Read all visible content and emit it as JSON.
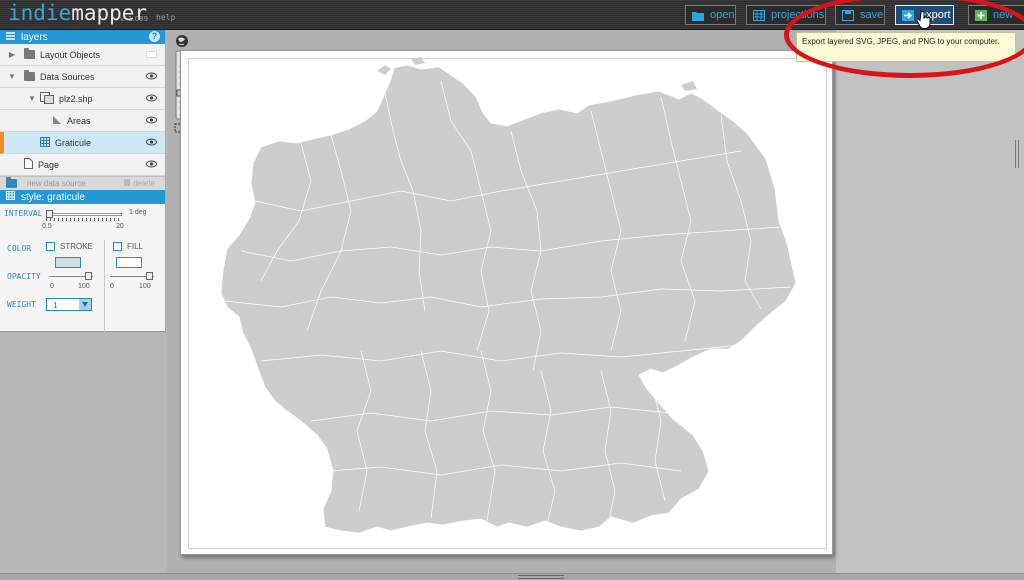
{
  "app": {
    "brand_part1": "indie",
    "brand_part2": "mapper",
    "version": "v. 1.089",
    "help": "help"
  },
  "toolbar": {
    "open": "open",
    "projections": "projections",
    "save": "save",
    "export": "export",
    "new": "new"
  },
  "tooltip": {
    "text": "Export layered SVG, JPEG, and PNG to your computer."
  },
  "layers_panel": {
    "title": "layers",
    "help_glyph": "?",
    "items": [
      {
        "label": "Layout Objects"
      },
      {
        "label": "Data Sources"
      },
      {
        "label": "plz2.shp"
      },
      {
        "label": "Areas"
      },
      {
        "label": "Graticule"
      },
      {
        "label": "Page"
      }
    ],
    "new_data_source": "new data source",
    "delete": "delete"
  },
  "style_panel": {
    "title": "style: graticule",
    "interval_label": "INTERVAL",
    "interval_max_text": "1 deg",
    "interval_min": "0.5",
    "interval_max": "20",
    "color_label": "COLOR",
    "stroke_label": "STROKE",
    "fill_label": "FILL",
    "opacity_label": "OPACITY",
    "opacity_min": "0",
    "opacity_max": "100",
    "weight_label": "WEIGHT",
    "weight_value": "1"
  },
  "colors": {
    "accent": "#2298d4",
    "selected_row": "#cde9f7",
    "selection_marker": "#f08a24",
    "map_fill": "#cdcdcd",
    "annotation": "#d8141a"
  }
}
